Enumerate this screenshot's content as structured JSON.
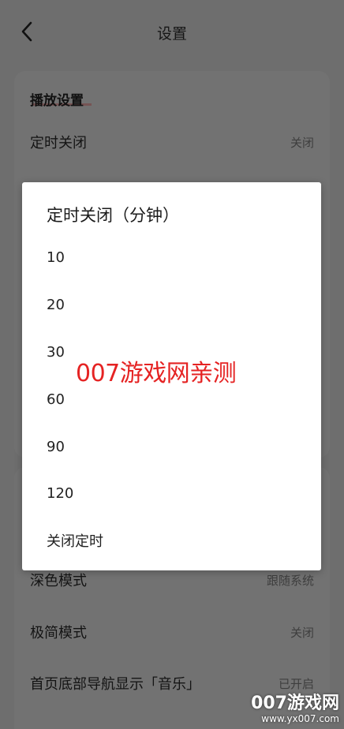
{
  "header": {
    "title": "设置"
  },
  "settings": {
    "section_title": "播放设置",
    "timer_row": {
      "label": "定时关闭",
      "value": "关闭"
    },
    "dark_mode_row": {
      "label": "深色模式",
      "value": "跟随系统"
    },
    "simple_mode_row": {
      "label": "极简模式",
      "value": "关闭"
    },
    "nav_music_row": {
      "label": "首页底部导航显示「音乐」",
      "value": "已开启"
    }
  },
  "dialog": {
    "title": "定时关闭（分钟）",
    "options": [
      "10",
      "20",
      "30",
      "60",
      "90",
      "120",
      "关闭定时"
    ]
  },
  "watermark": {
    "center_text": "007游戏网亲测",
    "logo_text": "007游戏网",
    "logo_url": "www.yx007.com"
  },
  "colors": {
    "overlay": "#6e6e6e",
    "watermark_red": "#e52323"
  }
}
